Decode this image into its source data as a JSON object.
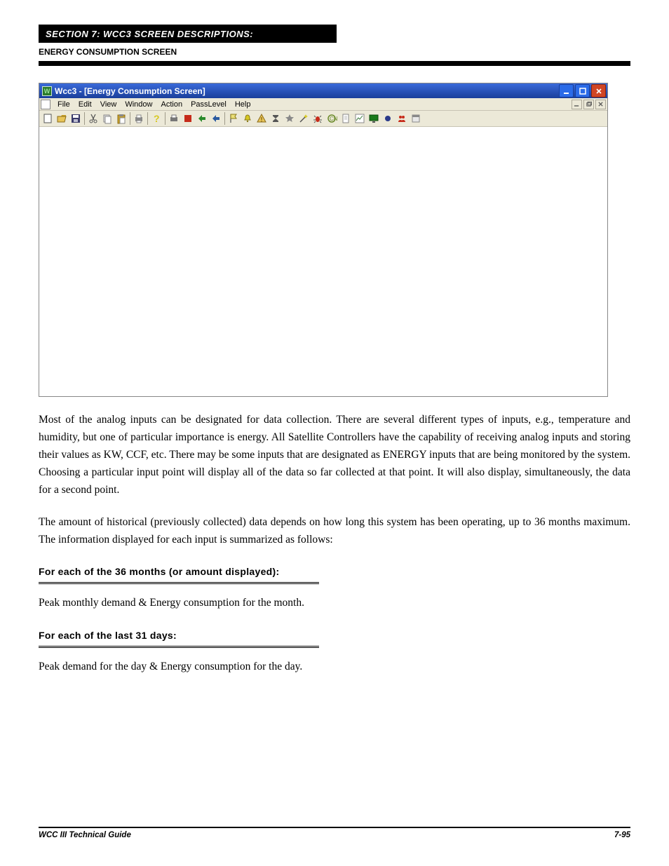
{
  "chapter": {
    "line1": "SECTION  7:  WCC3  SCREEN  DESCRIPTIONS:",
    "line2": "ENERGY CONSUMPTION SCREEN"
  },
  "window": {
    "title": "Wcc3 - [Energy Consumption Screen]",
    "menus": [
      "File",
      "Edit",
      "View",
      "Window",
      "Action",
      "PassLevel",
      "Help"
    ],
    "toolbar_names": [
      "new-icon",
      "open-icon",
      "save-icon",
      "sep",
      "cut-icon",
      "copy-icon",
      "paste-icon",
      "sep",
      "print-icon",
      "sep",
      "help-icon",
      "sep",
      "print-alt-icon",
      "red-action-icon",
      "go-green-icon",
      "go-blue-icon",
      "sep",
      "flag-icon",
      "bell-icon",
      "alert-icon",
      "sigma-icon",
      "star-icon",
      "wand-icon",
      "bug-icon",
      "circle-icon",
      "doc-icon",
      "chart-icon",
      "monitor-green-icon",
      "record-icon",
      "people-icon",
      "panel-icon"
    ]
  },
  "body": {
    "p1": "Most of the analog inputs can be designated for data collection. There are several different types of inputs, e.g., temperature and humidity, but one of particular importance is energy. All Satellite Controllers have the capability of receiving analog inputs and storing their values as KW, CCF, etc. There may be some inputs that are designated as ENERGY inputs that are being monitored by the system. Choosing a particular input point will display all of the data so far collected at that point. It will also display, simultaneously, the data for a second point.",
    "p2": "The amount of historical (previously collected) data depends on how long this system has been operating, up to 36 months maximum. The information displayed for each input is summarized as follows:",
    "sec1_head": "For each of the 36 months (or amount displayed):",
    "sec1_p": "Peak monthly demand & Energy consumption for the month.",
    "sec2_head": "For each of the last 31 days:",
    "sec2_p": "Peak demand for the day & Energy consumption for the day."
  },
  "footer": {
    "left": "WCC III Technical Guide",
    "right": "7-95"
  }
}
